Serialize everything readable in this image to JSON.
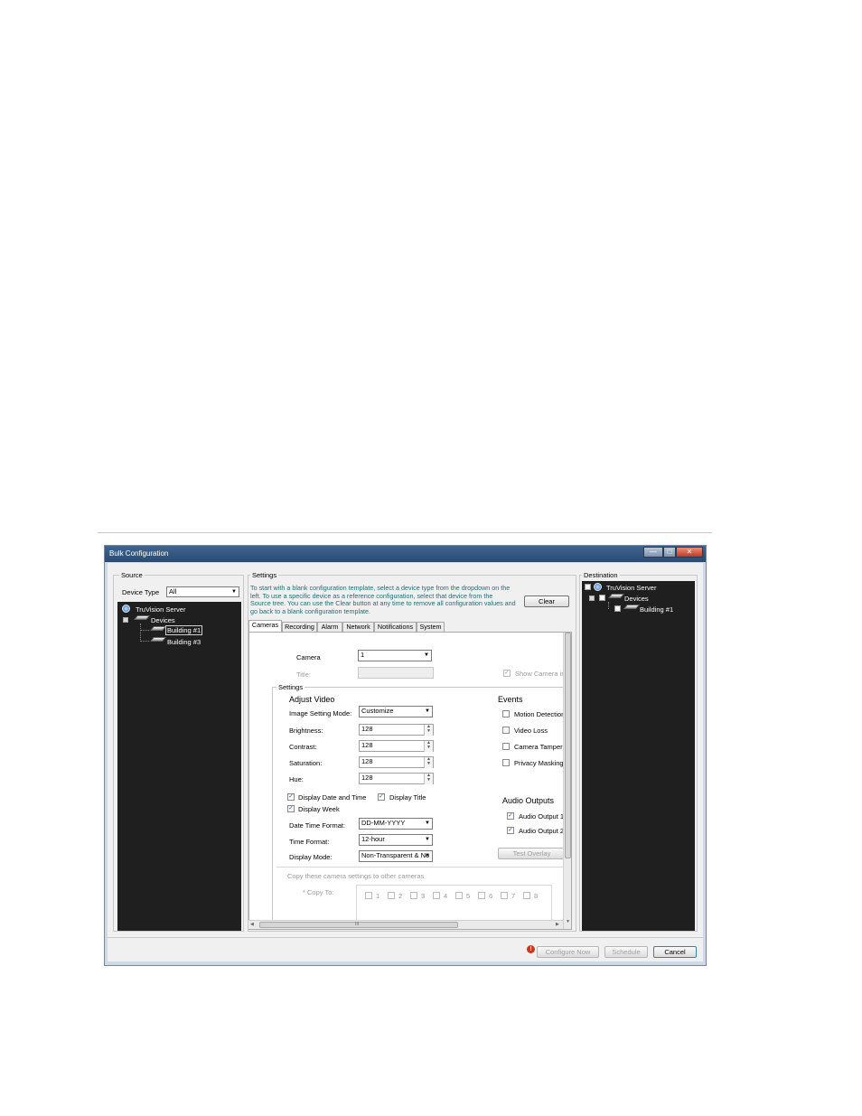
{
  "window": {
    "title": "Bulk Configuration",
    "controls": {
      "minimize": "—",
      "maximize": "□",
      "close": "✕"
    }
  },
  "source": {
    "legend": "Source",
    "device_type_label": "Device Type",
    "device_type_value": "All",
    "tree": {
      "root": "TruVision Server",
      "devices": "Devices",
      "items": [
        "Building #1",
        "Building #3"
      ]
    }
  },
  "settings": {
    "legend": "Settings",
    "info": "To start with a blank configuration template, select a device type from the dropdown on the left. To use a specific device as a reference configuration, select that device from the Source tree. You can use the Clear button at any time to remove all configuration values and go back to a blank configuration template.",
    "info_lines": [
      "To start with a blank configuration template, select a device type from the dropdown on the",
      "left. To use a specific device as a reference configuration, select that device from the",
      "Source tree. You can use the Clear button at any time to remove all configuration values and",
      "go back to a blank configuration template."
    ],
    "clear_label": "Clear",
    "tabs": [
      "Cameras",
      "Recording",
      "Alarm",
      "Network",
      "Notifications",
      "System"
    ],
    "camera_label": "Camera",
    "camera_value": "1",
    "title_label": "Title:",
    "show_camera_label": "Show Camera in",
    "inner_legend": "Settings",
    "adjust_video_heading": "Adjust Video",
    "image_setting_mode_label": "Image Setting Mode:",
    "image_setting_mode_value": "Customize",
    "brightness_label": "Brightness:",
    "brightness_value": "128",
    "contrast_label": "Contrast:",
    "contrast_value": "128",
    "saturation_label": "Saturation:",
    "saturation_value": "128",
    "hue_label": "Hue:",
    "hue_value": "128",
    "display_date_time_label": "Display Date and Time",
    "display_title_label": "Display Title",
    "display_week_label": "Display Week",
    "date_time_format_label": "Date Time Format:",
    "date_time_format_value": "DD-MM-YYYY",
    "time_format_label": "Time Format:",
    "time_format_value": "12-hour",
    "display_mode_label": "Display Mode:",
    "display_mode_value": "Non-Transparent & No",
    "events_heading": "Events",
    "events": [
      "Motion Detection",
      "Video Loss",
      "Camera Tampering",
      "Privacy Masking"
    ],
    "audio_outputs_heading": "Audio Outputs",
    "audio_outputs": [
      "Audio Output 1",
      "Audio Output 2"
    ],
    "test_overlay_label": "Test Overlay",
    "copy_hint": "Copy these camera settings to other cameras",
    "copy_to_label": "* Copy To:",
    "copy_cameras": [
      "1",
      "2",
      "3",
      "4",
      "5",
      "6",
      "7",
      "8"
    ],
    "hscroll_grip": "III"
  },
  "destination": {
    "legend": "Destination",
    "tree": {
      "root": "TruVision Server",
      "devices": "Devices",
      "items": [
        "Building #1"
      ]
    }
  },
  "footer": {
    "warning_icon": "!",
    "configure_now_label": "Configure Now",
    "schedule_label": "Schedule",
    "cancel_label": "Cancel"
  },
  "colors": {
    "tree_background": "#1f1f1f",
    "info_text": "#1f6e75",
    "titlebar": "#3f6590"
  }
}
